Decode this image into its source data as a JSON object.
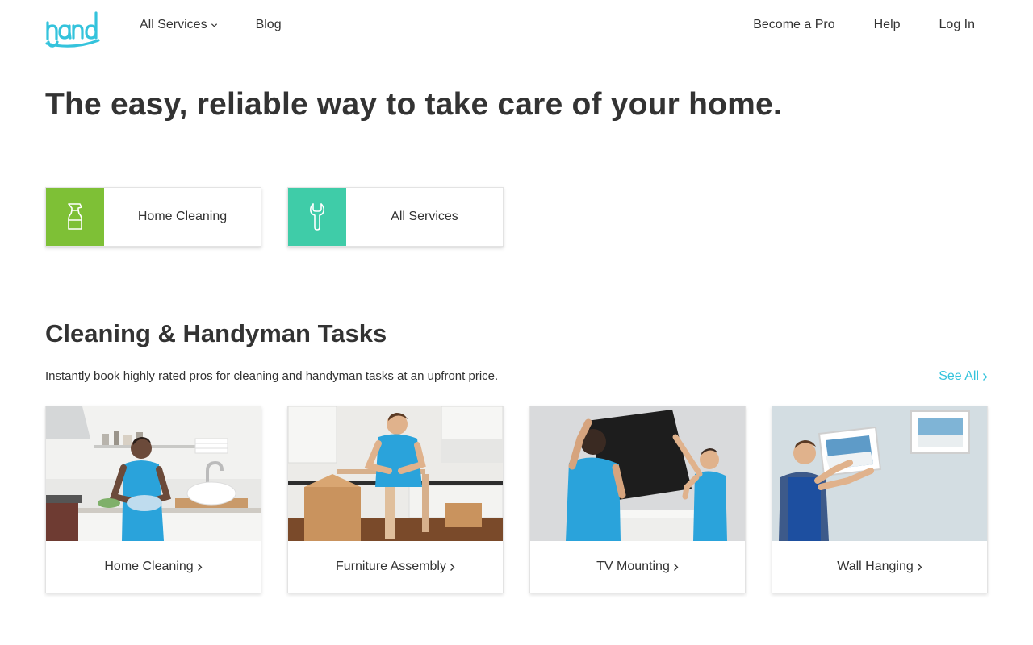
{
  "header": {
    "logo_text": "handy",
    "nav_left": [
      {
        "label": "All Services",
        "has_dropdown": true
      },
      {
        "label": "Blog",
        "has_dropdown": false
      }
    ],
    "nav_right": [
      {
        "label": "Become a Pro"
      },
      {
        "label": "Help"
      },
      {
        "label": "Log In"
      }
    ]
  },
  "hero": {
    "title": "The easy, reliable way to take care of your home."
  },
  "service_buttons": [
    {
      "label": "Home Cleaning",
      "icon": "spray-bottle-icon",
      "color": "#7ec036"
    },
    {
      "label": "All Services",
      "icon": "wrench-icon",
      "color": "#3fcca8"
    }
  ],
  "tasks_section": {
    "title": "Cleaning & Handyman Tasks",
    "subtitle": "Instantly book highly rated pros for cleaning and handyman tasks at an upfront price.",
    "see_all": "See All",
    "cards": [
      {
        "label": "Home Cleaning",
        "photo": "kitchen-cleaning-photo"
      },
      {
        "label": "Furniture Assembly",
        "photo": "furniture-assembly-photo"
      },
      {
        "label": "TV Mounting",
        "photo": "tv-mounting-photo"
      },
      {
        "label": "Wall Hanging",
        "photo": "wall-hanging-photo"
      }
    ]
  },
  "colors": {
    "brand": "#34c3dc",
    "text": "#333333",
    "green": "#7ec036",
    "teal": "#3fcca8"
  }
}
